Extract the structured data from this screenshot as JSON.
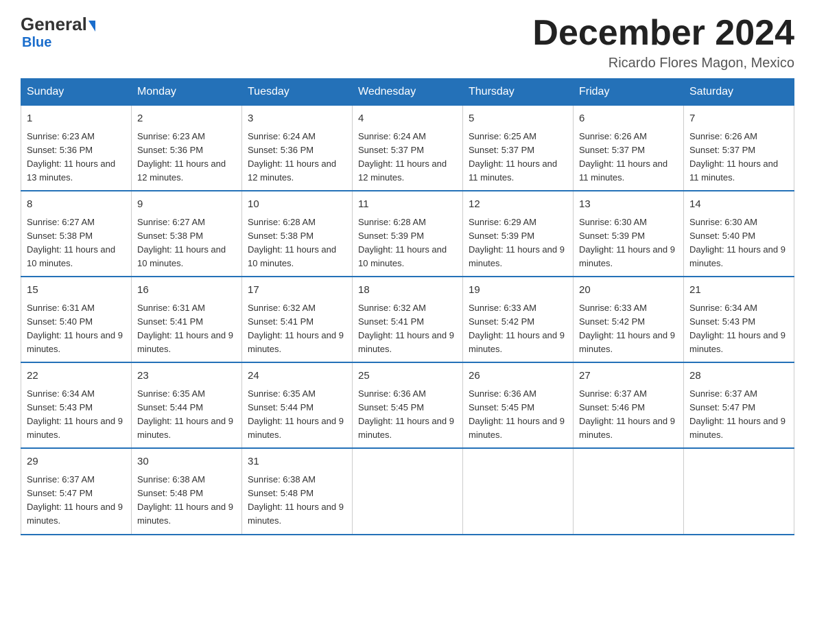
{
  "logo": {
    "general": "General",
    "blue": "Blue"
  },
  "title": "December 2024",
  "location": "Ricardo Flores Magon, Mexico",
  "days_of_week": [
    "Sunday",
    "Monday",
    "Tuesday",
    "Wednesday",
    "Thursday",
    "Friday",
    "Saturday"
  ],
  "weeks": [
    [
      {
        "day": "1",
        "sunrise": "6:23 AM",
        "sunset": "5:36 PM",
        "daylight": "11 hours and 13 minutes."
      },
      {
        "day": "2",
        "sunrise": "6:23 AM",
        "sunset": "5:36 PM",
        "daylight": "11 hours and 12 minutes."
      },
      {
        "day": "3",
        "sunrise": "6:24 AM",
        "sunset": "5:36 PM",
        "daylight": "11 hours and 12 minutes."
      },
      {
        "day": "4",
        "sunrise": "6:24 AM",
        "sunset": "5:37 PM",
        "daylight": "11 hours and 12 minutes."
      },
      {
        "day": "5",
        "sunrise": "6:25 AM",
        "sunset": "5:37 PM",
        "daylight": "11 hours and 11 minutes."
      },
      {
        "day": "6",
        "sunrise": "6:26 AM",
        "sunset": "5:37 PM",
        "daylight": "11 hours and 11 minutes."
      },
      {
        "day": "7",
        "sunrise": "6:26 AM",
        "sunset": "5:37 PM",
        "daylight": "11 hours and 11 minutes."
      }
    ],
    [
      {
        "day": "8",
        "sunrise": "6:27 AM",
        "sunset": "5:38 PM",
        "daylight": "11 hours and 10 minutes."
      },
      {
        "day": "9",
        "sunrise": "6:27 AM",
        "sunset": "5:38 PM",
        "daylight": "11 hours and 10 minutes."
      },
      {
        "day": "10",
        "sunrise": "6:28 AM",
        "sunset": "5:38 PM",
        "daylight": "11 hours and 10 minutes."
      },
      {
        "day": "11",
        "sunrise": "6:28 AM",
        "sunset": "5:39 PM",
        "daylight": "11 hours and 10 minutes."
      },
      {
        "day": "12",
        "sunrise": "6:29 AM",
        "sunset": "5:39 PM",
        "daylight": "11 hours and 9 minutes."
      },
      {
        "day": "13",
        "sunrise": "6:30 AM",
        "sunset": "5:39 PM",
        "daylight": "11 hours and 9 minutes."
      },
      {
        "day": "14",
        "sunrise": "6:30 AM",
        "sunset": "5:40 PM",
        "daylight": "11 hours and 9 minutes."
      }
    ],
    [
      {
        "day": "15",
        "sunrise": "6:31 AM",
        "sunset": "5:40 PM",
        "daylight": "11 hours and 9 minutes."
      },
      {
        "day": "16",
        "sunrise": "6:31 AM",
        "sunset": "5:41 PM",
        "daylight": "11 hours and 9 minutes."
      },
      {
        "day": "17",
        "sunrise": "6:32 AM",
        "sunset": "5:41 PM",
        "daylight": "11 hours and 9 minutes."
      },
      {
        "day": "18",
        "sunrise": "6:32 AM",
        "sunset": "5:41 PM",
        "daylight": "11 hours and 9 minutes."
      },
      {
        "day": "19",
        "sunrise": "6:33 AM",
        "sunset": "5:42 PM",
        "daylight": "11 hours and 9 minutes."
      },
      {
        "day": "20",
        "sunrise": "6:33 AM",
        "sunset": "5:42 PM",
        "daylight": "11 hours and 9 minutes."
      },
      {
        "day": "21",
        "sunrise": "6:34 AM",
        "sunset": "5:43 PM",
        "daylight": "11 hours and 9 minutes."
      }
    ],
    [
      {
        "day": "22",
        "sunrise": "6:34 AM",
        "sunset": "5:43 PM",
        "daylight": "11 hours and 9 minutes."
      },
      {
        "day": "23",
        "sunrise": "6:35 AM",
        "sunset": "5:44 PM",
        "daylight": "11 hours and 9 minutes."
      },
      {
        "day": "24",
        "sunrise": "6:35 AM",
        "sunset": "5:44 PM",
        "daylight": "11 hours and 9 minutes."
      },
      {
        "day": "25",
        "sunrise": "6:36 AM",
        "sunset": "5:45 PM",
        "daylight": "11 hours and 9 minutes."
      },
      {
        "day": "26",
        "sunrise": "6:36 AM",
        "sunset": "5:45 PM",
        "daylight": "11 hours and 9 minutes."
      },
      {
        "day": "27",
        "sunrise": "6:37 AM",
        "sunset": "5:46 PM",
        "daylight": "11 hours and 9 minutes."
      },
      {
        "day": "28",
        "sunrise": "6:37 AM",
        "sunset": "5:47 PM",
        "daylight": "11 hours and 9 minutes."
      }
    ],
    [
      {
        "day": "29",
        "sunrise": "6:37 AM",
        "sunset": "5:47 PM",
        "daylight": "11 hours and 9 minutes."
      },
      {
        "day": "30",
        "sunrise": "6:38 AM",
        "sunset": "5:48 PM",
        "daylight": "11 hours and 9 minutes."
      },
      {
        "day": "31",
        "sunrise": "6:38 AM",
        "sunset": "5:48 PM",
        "daylight": "11 hours and 9 minutes."
      },
      null,
      null,
      null,
      null
    ]
  ],
  "labels": {
    "sunrise": "Sunrise:",
    "sunset": "Sunset:",
    "daylight": "Daylight:"
  }
}
